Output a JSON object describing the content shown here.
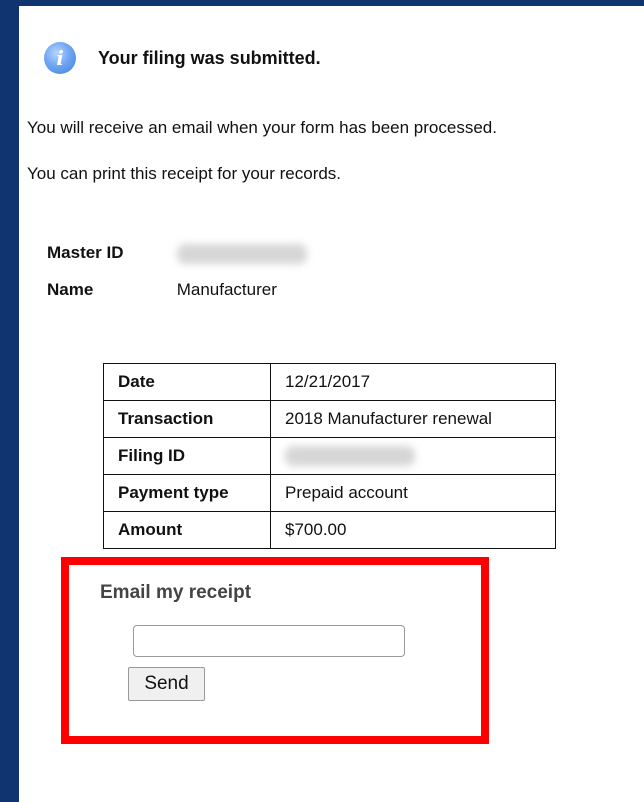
{
  "notice": {
    "icon": "info-icon",
    "title": "Your filing was submitted."
  },
  "messages": [
    "You will receive an email when your form has been processed.",
    "You can print this receipt for your records."
  ],
  "account": {
    "master_id_label": "Master ID",
    "master_id_value": "",
    "name_label": "Name",
    "name_value": "Manufacturer"
  },
  "receipt": {
    "rows": [
      {
        "label": "Date",
        "value": "12/21/2017"
      },
      {
        "label": "Transaction",
        "value": "2018 Manufacturer renewal"
      },
      {
        "label": "Filing ID",
        "value": ""
      },
      {
        "label": "Payment type",
        "value": "Prepaid account"
      },
      {
        "label": "Amount",
        "value": "$700.00"
      }
    ]
  },
  "email_receipt": {
    "title": "Email my receipt",
    "input_value": "",
    "send_label": "Send",
    "highlight_color": "#ff0000"
  },
  "colors": {
    "frame": "#0f3470",
    "info_icon": "#5a96e6"
  }
}
